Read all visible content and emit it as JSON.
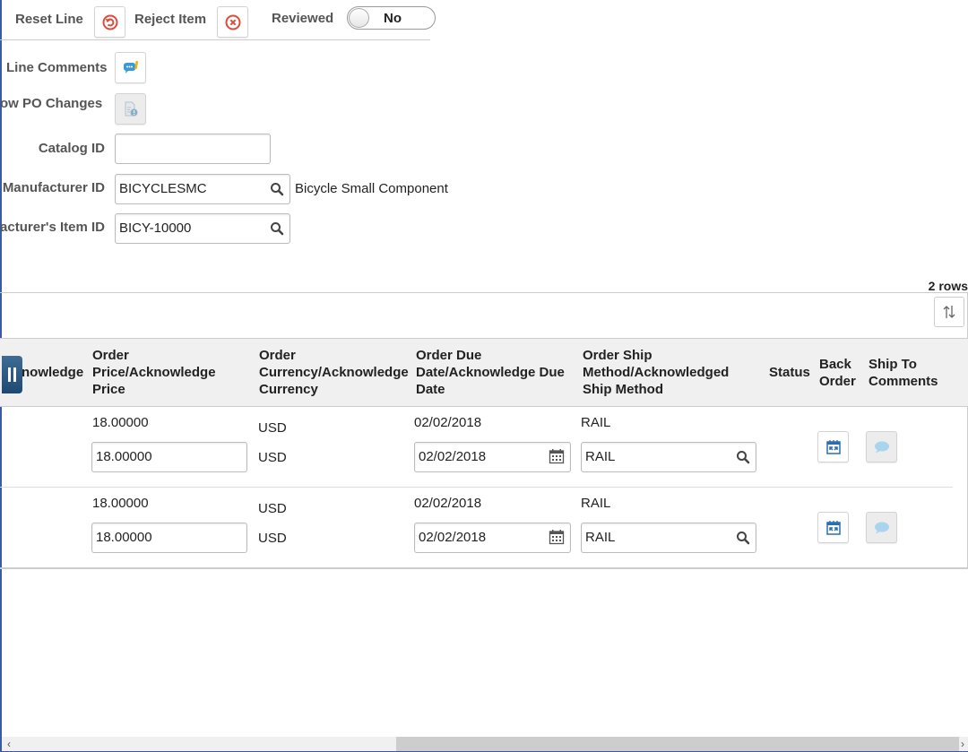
{
  "toolbar": {
    "reset_line_label": "Reset Line",
    "reject_item_label": "Reject Item",
    "reviewed_label": "Reviewed",
    "reviewed_value": "No"
  },
  "form": {
    "line_comments_label": "Line Comments",
    "show_po_changes_label": "ow PO Changes",
    "catalog_id_label": "Catalog ID",
    "catalog_id_value": "",
    "manufacturer_id_label": "Manufacturer ID",
    "manufacturer_id_value": "BICYCLESMC",
    "manufacturer_description": "Bicycle Small Component",
    "mfg_item_id_label": "acturer's Item ID",
    "mfg_item_id_value": "BICY-10000"
  },
  "grid": {
    "row_count": "2 rows",
    "columns": [
      {
        "line1": "",
        "line2": "nowledge",
        "line3": ""
      },
      {
        "line1": "Order",
        "line2": "Price/Acknowledge",
        "line3": "Price"
      },
      {
        "line1": "Order",
        "line2": "Currency/Acknowledge",
        "line3": "Currency"
      },
      {
        "line1": "Order Due",
        "line2": "Date/Acknowledge Due",
        "line3": "Date"
      },
      {
        "line1": "Order Ship",
        "line2": "Method/Acknowledged",
        "line3": "Ship Method"
      },
      {
        "line1": "",
        "line2": "Status",
        "line3": ""
      },
      {
        "line1": "Back",
        "line2": "Order",
        "line3": ""
      },
      {
        "line1": "Ship To",
        "line2": "Comments",
        "line3": ""
      }
    ],
    "rows": [
      {
        "order_price": "18.00000",
        "ack_price": "18.00000",
        "order_currency": "USD",
        "ack_currency": "USD",
        "order_due_date": "02/02/2018",
        "ack_due_date": "02/02/2018",
        "order_ship_method": "RAIL",
        "ack_ship_method": "RAIL",
        "status": ""
      },
      {
        "order_price": "18.00000",
        "ack_price": "18.00000",
        "order_currency": "USD",
        "ack_currency": "USD",
        "order_due_date": "02/02/2018",
        "ack_due_date": "02/02/2018",
        "order_ship_method": "RAIL",
        "ack_ship_method": "RAIL",
        "status": ""
      }
    ]
  },
  "colors": {
    "reset_reject_icon": "#e04a3a",
    "comment_icon": "#3a9ad9",
    "freeze_handle": "#2a5580"
  }
}
